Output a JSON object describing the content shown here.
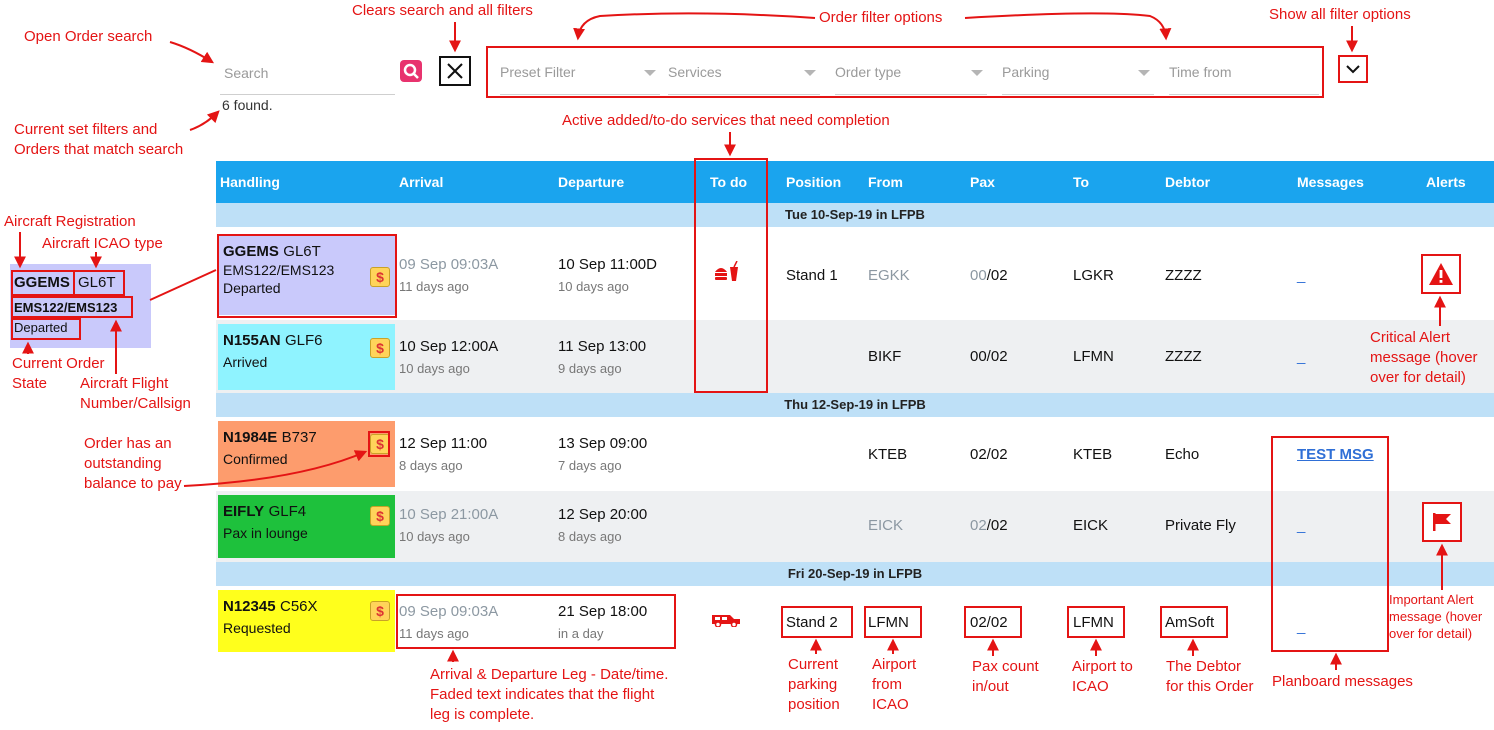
{
  "search": {
    "placeholder": "Search",
    "found": "6 found."
  },
  "filters": [
    {
      "label": "Preset Filter"
    },
    {
      "label": "Services"
    },
    {
      "label": "Order type"
    },
    {
      "label": "Parking"
    },
    {
      "label": "Time from"
    }
  ],
  "columns": {
    "handling": "Handling",
    "arrival": "Arrival",
    "departure": "Departure",
    "todo": "To do",
    "position": "Position",
    "from": "From",
    "pax": "Pax",
    "to": "To",
    "debtor": "Debtor",
    "messages": "Messages",
    "alerts": "Alerts"
  },
  "dates": [
    "Tue 10-Sep-19 in LFPB",
    "Thu 12-Sep-19 in LFPB",
    "Fri 20-Sep-19 in LFPB"
  ],
  "orders": [
    {
      "reg": "GGEMS",
      "type": "GL6T",
      "flight": "EMS122/EMS123",
      "state": "Departed",
      "color": "#c9c9fb",
      "arr": "09 Sep 09:03A",
      "arr_rel": "11 days ago",
      "dep": "10 Sep 11:00D",
      "dep_rel": "10 days ago",
      "position": "Stand 1",
      "from": "EGKK",
      "pax_in": "00",
      "pax_out": "/02",
      "to": "LGKR",
      "debtor": "ZZZZ",
      "message": "_"
    },
    {
      "reg": "N155AN",
      "type": "GLF6",
      "flight": "",
      "state": "Arrived",
      "color": "#8ff3ff",
      "arr": "10 Sep 12:00A",
      "arr_rel": "10 days ago",
      "dep": "11 Sep 13:00",
      "dep_rel": "9 days ago",
      "position": "",
      "from": "BIKF",
      "pax": "00/02",
      "to": "LFMN",
      "debtor": "ZZZZ",
      "message": "_"
    },
    {
      "reg": "N1984E",
      "type": "B737",
      "flight": "",
      "state": "Confirmed",
      "color": "#fd9c6d",
      "arr": "12 Sep 11:00",
      "arr_rel": "8 days ago",
      "dep": "13 Sep 09:00",
      "dep_rel": "7 days ago",
      "position": "",
      "from": "KTEB",
      "pax": "02/02",
      "to": "KTEB",
      "debtor": "Echo",
      "message": "TEST MSG"
    },
    {
      "reg": "EIFLY",
      "type": "GLF4",
      "flight": "",
      "state": "Pax in lounge",
      "color": "#1ec13c",
      "arr": "10 Sep 21:00A",
      "arr_rel": "10 days ago",
      "dep": "12 Sep 20:00",
      "dep_rel": "8 days ago",
      "position": "",
      "from": "EICK",
      "pax_in": "02",
      "pax_out": "/02",
      "to": "EICK",
      "debtor": "Private Fly",
      "message": "_"
    },
    {
      "reg": "N12345",
      "type": "C56X",
      "flight": "",
      "state": "Requested",
      "color": "#ffff1c",
      "arr": "09 Sep 09:03A",
      "arr_rel": "11 days ago",
      "dep": "21 Sep 18:00",
      "dep_rel": "in a day",
      "position": "Stand 2",
      "from": "LFMN",
      "pax": "02/02",
      "to": "LFMN",
      "debtor": "AmSoft",
      "message": "_"
    }
  ],
  "mini": {
    "reg": "GGEMS",
    "type": "GL6T",
    "flight": "EMS122/EMS123",
    "state": "Departed"
  },
  "annotations": {
    "open_search": "Open Order search",
    "clears": "Clears search and all filters",
    "filter_options": "Order filter options",
    "show_all": "Show all filter options",
    "current_filters_1": "Current set filters and",
    "current_filters_2": "Orders that match search",
    "active_services": "Active added/to-do services that need completion",
    "aircraft_reg": "Aircraft Registration",
    "icao_type": "Aircraft ICAO type",
    "current_state_1": "Current Order",
    "current_state_2": "State",
    "flight_1": "Aircraft Flight",
    "flight_2": "Number/Callsign",
    "balance_1": "Order has an",
    "balance_2": "outstanding",
    "balance_3": "balance to pay",
    "critical_1": "Critical Alert",
    "critical_2": "message (hover",
    "critical_3": "over for detail)",
    "important_1": "Important Alert",
    "important_2": "message (hover",
    "important_3": "over for detail)",
    "legs_1": "Arrival & Departure Leg - Date/time.",
    "legs_2": "Faded text indicates that the flight",
    "legs_3": "leg is complete.",
    "parking_1": "Current",
    "parking_2": "parking",
    "parking_3": "position",
    "from_1": "Airport",
    "from_2": "from",
    "from_3": "ICAO",
    "pax_1": "Pax count",
    "pax_2": "in/out",
    "to_1": "Airport to",
    "to_2": "ICAO",
    "debtor_1": "The Debtor",
    "debtor_2": "for this Order",
    "planboard": "Planboard messages"
  },
  "colors": {
    "header": "#1aa4ee",
    "date_row": "#bee0f7",
    "annotation": "#e41414"
  }
}
